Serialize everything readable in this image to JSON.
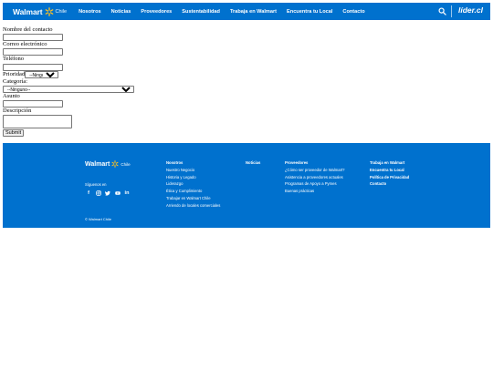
{
  "header": {
    "brand": "Walmart",
    "brand_region": "Chile",
    "nav": [
      "Nosotros",
      "Noticias",
      "Proveedores",
      "Sustentabilidad",
      "Trabaja en Walmart",
      "Encuentra tu Local",
      "Contacto"
    ],
    "partner": "líder.cl",
    "colors": {
      "bar": "#0071ce",
      "spark": "#ffc220"
    }
  },
  "form": {
    "contact_name_label": "Nombre del contacto",
    "email_label": "Correo electrónico",
    "phone_label": "Teléfono",
    "priority_label": "Prioridad",
    "priority_value": "--Ninguno--",
    "category_label": "Categoría:",
    "category_value": "--Ninguno--",
    "subject_label": "Asunto",
    "description_label": "Descripción",
    "submit_label": "Submit"
  },
  "footer": {
    "brand": "Walmart",
    "brand_region": "Chile",
    "follow_label": "Síguenos en",
    "social_icons": [
      "facebook-icon",
      "instagram-icon",
      "twitter-icon",
      "youtube-icon",
      "linkedin-icon"
    ],
    "copyright": "© Walmart Chile",
    "columns": [
      {
        "heading": "Nosotros",
        "links": [
          "Nuestro Negocio",
          "Historia y Legado",
          "Liderazgo",
          "Ética y Cumplimiento",
          "Trabajar en Walmart Chile",
          "Arriendo de locales comerciales"
        ]
      },
      {
        "heading": "Noticias",
        "links": []
      },
      {
        "heading": "Proveedores",
        "links": [
          "¿Cómo ser proveedor de Walmart?",
          "Asistencia a proveedores actuales",
          "Programas de Apoyo a Pymes",
          "Buenas prácticas"
        ]
      },
      {
        "heading": "Trabaja en Walmart",
        "links": [
          "Encuentra tu Local",
          "Política de Privacidad",
          "Contacto"
        ]
      }
    ]
  }
}
